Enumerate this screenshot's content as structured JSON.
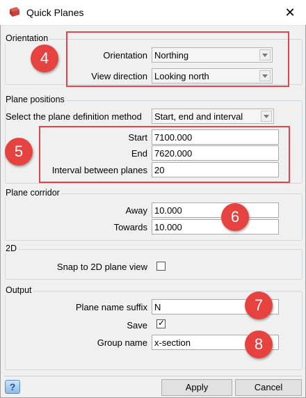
{
  "window": {
    "title": "Quick Planes",
    "close_glyph": "✕"
  },
  "orientation": {
    "title": "Orientation",
    "orientation_label": "Orientation",
    "orientation_value": "Northing",
    "view_direction_label": "View direction",
    "view_direction_value": "Looking north"
  },
  "plane_positions": {
    "title": "Plane positions",
    "method_label": "Select the plane definition method",
    "method_value": "Start, end and interval",
    "start_label": "Start",
    "start_value": "7100.000",
    "end_label": "End",
    "end_value": "7620.000",
    "interval_label": "Interval between planes",
    "interval_value": "20"
  },
  "plane_corridor": {
    "title": "Plane corridor",
    "away_label": "Away",
    "away_value": "10.000",
    "towards_label": "Towards",
    "towards_value": "10.000"
  },
  "two_d": {
    "title": "2D",
    "snap_label": "Snap to 2D plane view",
    "snap_checked": false
  },
  "output": {
    "title": "Output",
    "suffix_label": "Plane name suffix",
    "suffix_value": "N",
    "save_label": "Save",
    "save_checked": true,
    "save_mark": "✓",
    "group_label": "Group name",
    "group_value": "x-section"
  },
  "callouts": [
    "4",
    "5",
    "6",
    "7",
    "8"
  ],
  "footer": {
    "help": "?",
    "apply": "Apply",
    "cancel": "Cancel"
  },
  "colors": {
    "callout": "#e6423f",
    "highlight_box": "#e0454a"
  }
}
